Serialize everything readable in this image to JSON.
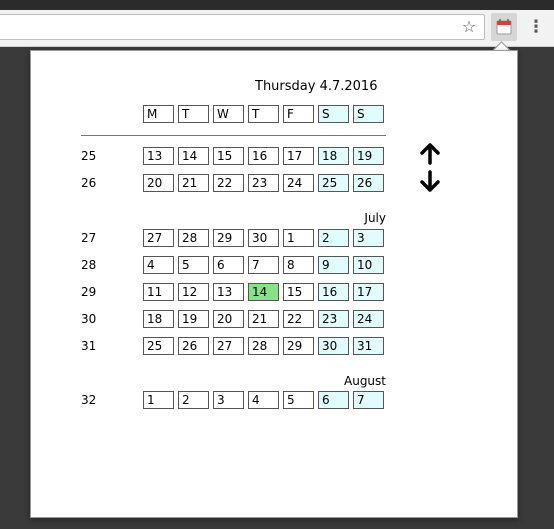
{
  "browser": {
    "star_glyph": "☆",
    "menu_glyph": "⋮",
    "extension_icon": "calendar-icon"
  },
  "calendar": {
    "date_title": "Thursday 4.7.2016",
    "day_headers": [
      "M",
      "T",
      "W",
      "T",
      "F",
      "S",
      "S"
    ],
    "nav": {
      "up_icon": "arrow-up-icon",
      "down_icon": "arrow-down-icon"
    },
    "colors": {
      "weekend": "#e0fcfc",
      "today": "#88e288"
    },
    "months": [
      {
        "label": "",
        "weeks": [
          {
            "num": "25",
            "days": [
              "13",
              "14",
              "15",
              "16",
              "17",
              "18",
              "19"
            ]
          },
          {
            "num": "26",
            "days": [
              "20",
              "21",
              "22",
              "23",
              "24",
              "25",
              "26"
            ]
          }
        ]
      },
      {
        "label": "July",
        "weeks": [
          {
            "num": "27",
            "days": [
              "27",
              "28",
              "29",
              "30",
              "1",
              "2",
              "3"
            ]
          },
          {
            "num": "28",
            "days": [
              "4",
              "5",
              "6",
              "7",
              "8",
              "9",
              "10"
            ]
          },
          {
            "num": "29",
            "days": [
              "11",
              "12",
              "13",
              "14",
              "15",
              "16",
              "17"
            ],
            "today_index": 3
          },
          {
            "num": "30",
            "days": [
              "18",
              "19",
              "20",
              "21",
              "22",
              "23",
              "24"
            ]
          },
          {
            "num": "31",
            "days": [
              "25",
              "26",
              "27",
              "28",
              "29",
              "30",
              "31"
            ]
          }
        ]
      },
      {
        "label": "August",
        "weeks": [
          {
            "num": "32",
            "days": [
              "1",
              "2",
              "3",
              "4",
              "5",
              "6",
              "7"
            ]
          }
        ]
      }
    ]
  }
}
